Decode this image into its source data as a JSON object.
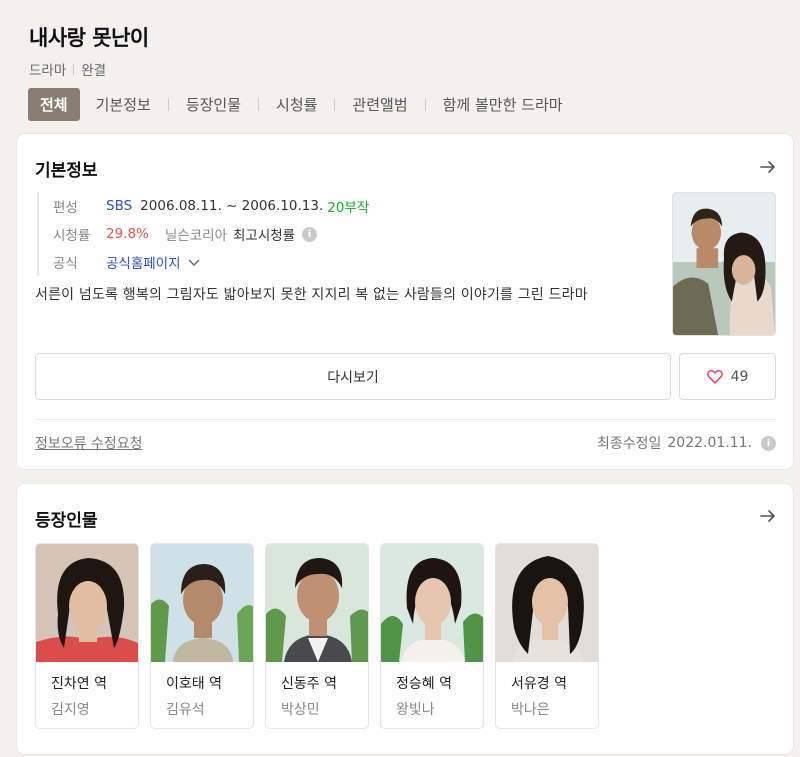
{
  "header": {
    "title": "내사랑 못난이",
    "genre": "드라마",
    "status": "완결",
    "tabs": [
      "전체",
      "기본정보",
      "등장인물",
      "시청률",
      "관련앨범",
      "함께 볼만한 드라마"
    ]
  },
  "basic_info": {
    "heading": "기본정보",
    "broadcast": {
      "label": "편성",
      "channel": "SBS",
      "period": "2006.08.11. ~ 2006.10.13.",
      "episodes": "20부작"
    },
    "rating": {
      "label": "시청률",
      "value": "29.8%",
      "source": "닐슨코리아",
      "kind": "최고시청률"
    },
    "official": {
      "label": "공식",
      "link": "공식홈페이지"
    },
    "description": "서른이 넘도록 행복의 그림자도 밟아보지 못한 지지리 복 없는 사람들의 이야기를 그린 드라마",
    "watch_label": "다시보기",
    "like_count": "49",
    "report_label": "정보오류 수정요청",
    "updated_label": "최종수정일",
    "updated_date": "2022.01.11."
  },
  "cast_section": {
    "heading": "등장인물",
    "people": [
      {
        "role": "진차연 역",
        "actor": "김지영"
      },
      {
        "role": "이호태 역",
        "actor": "김유석"
      },
      {
        "role": "신동주 역",
        "actor": "박상민"
      },
      {
        "role": "정승혜 역",
        "actor": "왕빛나"
      },
      {
        "role": "서유경 역",
        "actor": "박나은"
      }
    ]
  },
  "colors": {
    "active_tab": "#8a7e72",
    "channel_link": "#2a55b0",
    "rating_value": "#e4584d",
    "episodes": "#1faa2b",
    "like_heart": "#e2475b"
  },
  "icons": {
    "more": "arrow-right-icon",
    "info": "info-icon",
    "dropdown": "chevron-down-icon",
    "like": "heart-icon"
  }
}
